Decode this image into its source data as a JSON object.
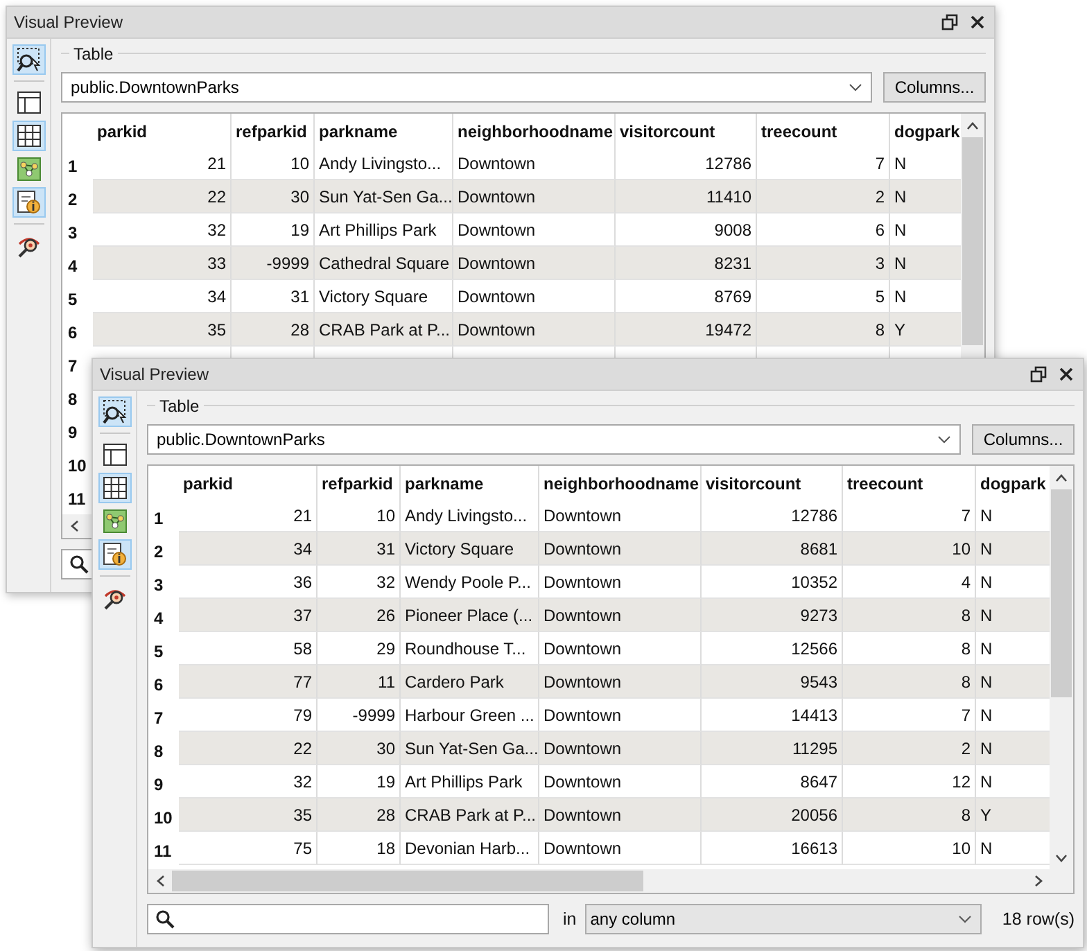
{
  "windows": [
    {
      "title": "Visual Preview",
      "toolbar": [
        {
          "kind": "zoom-selection",
          "selected": true
        },
        {
          "kind": "panel",
          "selected": false
        },
        {
          "kind": "grid",
          "selected": true
        },
        {
          "kind": "graph",
          "selected": false
        },
        {
          "kind": "info",
          "selected": true
        },
        {
          "kind": "inspect",
          "selected": false
        }
      ],
      "group_label": "Table",
      "table_select": "public.DowntownParks",
      "columns_button": "Columns...",
      "table": {
        "columns": [
          {
            "label": "parkid"
          },
          {
            "label": "refparkid"
          },
          {
            "label": "parkname"
          },
          {
            "label": "neighborhoodname"
          },
          {
            "label": "visitorcount"
          },
          {
            "label": "treecount"
          },
          {
            "label": "dogpark"
          }
        ],
        "rows": [
          {
            "number": "1",
            "cells": [
              "21",
              "10",
              "Andy Livingsto...",
              "Downtown",
              "12786",
              "7",
              "N"
            ]
          },
          {
            "number": "2",
            "cells": [
              "22",
              "30",
              "Sun Yat-Sen Ga...",
              "Downtown",
              "11410",
              "2",
              "N"
            ]
          },
          {
            "number": "3",
            "cells": [
              "32",
              "19",
              "Art Phillips Park",
              "Downtown",
              "9008",
              "6",
              "N"
            ]
          },
          {
            "number": "4",
            "cells": [
              "33",
              "-9999",
              "Cathedral Square",
              "Downtown",
              "8231",
              "3",
              "N"
            ]
          },
          {
            "number": "5",
            "cells": [
              "34",
              "31",
              "Victory Square",
              "Downtown",
              "8769",
              "5",
              "N"
            ]
          },
          {
            "number": "6",
            "cells": [
              "35",
              "28",
              "CRAB Park at P...",
              "Downtown",
              "19472",
              "8",
              "Y"
            ]
          },
          {
            "number": "7"
          },
          {
            "number": "8"
          },
          {
            "number": "9"
          },
          {
            "number": "10"
          },
          {
            "number": "11"
          }
        ]
      }
    },
    {
      "title": "Visual Preview",
      "toolbar": [
        {
          "kind": "zoom-selection",
          "selected": true
        },
        {
          "kind": "panel",
          "selected": false
        },
        {
          "kind": "grid",
          "selected": true
        },
        {
          "kind": "graph",
          "selected": false
        },
        {
          "kind": "info",
          "selected": true
        },
        {
          "kind": "inspect",
          "selected": false
        }
      ],
      "group_label": "Table",
      "table_select": "public.DowntownParks",
      "columns_button": "Columns...",
      "table": {
        "columns": [
          {
            "label": "parkid"
          },
          {
            "label": "refparkid"
          },
          {
            "label": "parkname"
          },
          {
            "label": "neighborhoodname"
          },
          {
            "label": "visitorcount"
          },
          {
            "label": "treecount"
          },
          {
            "label": "dogpark"
          }
        ],
        "rows": [
          {
            "number": "1",
            "cells": [
              "21",
              "10",
              "Andy Livingsto...",
              "Downtown",
              "12786",
              "7",
              "N"
            ]
          },
          {
            "number": "2",
            "cells": [
              "34",
              "31",
              "Victory Square",
              "Downtown",
              "8681",
              "10",
              "N"
            ]
          },
          {
            "number": "3",
            "cells": [
              "36",
              "32",
              "Wendy Poole P...",
              "Downtown",
              "10352",
              "4",
              "N"
            ]
          },
          {
            "number": "4",
            "cells": [
              "37",
              "26",
              "Pioneer Place (...",
              "Downtown",
              "9273",
              "8",
              "N"
            ]
          },
          {
            "number": "5",
            "cells": [
              "58",
              "29",
              "Roundhouse T...",
              "Downtown",
              "12566",
              "8",
              "N"
            ]
          },
          {
            "number": "6",
            "cells": [
              "77",
              "11",
              "Cardero Park",
              "Downtown",
              "9543",
              "8",
              "N"
            ]
          },
          {
            "number": "7",
            "cells": [
              "79",
              "-9999",
              "Harbour Green ...",
              "Downtown",
              "14413",
              "7",
              "N"
            ]
          },
          {
            "number": "8",
            "cells": [
              "22",
              "30",
              "Sun Yat-Sen Ga...",
              "Downtown",
              "11295",
              "2",
              "N"
            ]
          },
          {
            "number": "9",
            "cells": [
              "32",
              "19",
              "Art Phillips Park",
              "Downtown",
              "8647",
              "12",
              "N"
            ]
          },
          {
            "number": "10",
            "cells": [
              "35",
              "28",
              "CRAB Park at P...",
              "Downtown",
              "20056",
              "8",
              "Y"
            ]
          },
          {
            "number": "11",
            "cells": [
              "75",
              "18",
              "Devonian Harb...",
              "Downtown",
              "16613",
              "10",
              "N"
            ]
          }
        ]
      },
      "search": {
        "in_label": "in",
        "column_select": "any column",
        "row_count": "18 row(s)"
      }
    }
  ]
}
